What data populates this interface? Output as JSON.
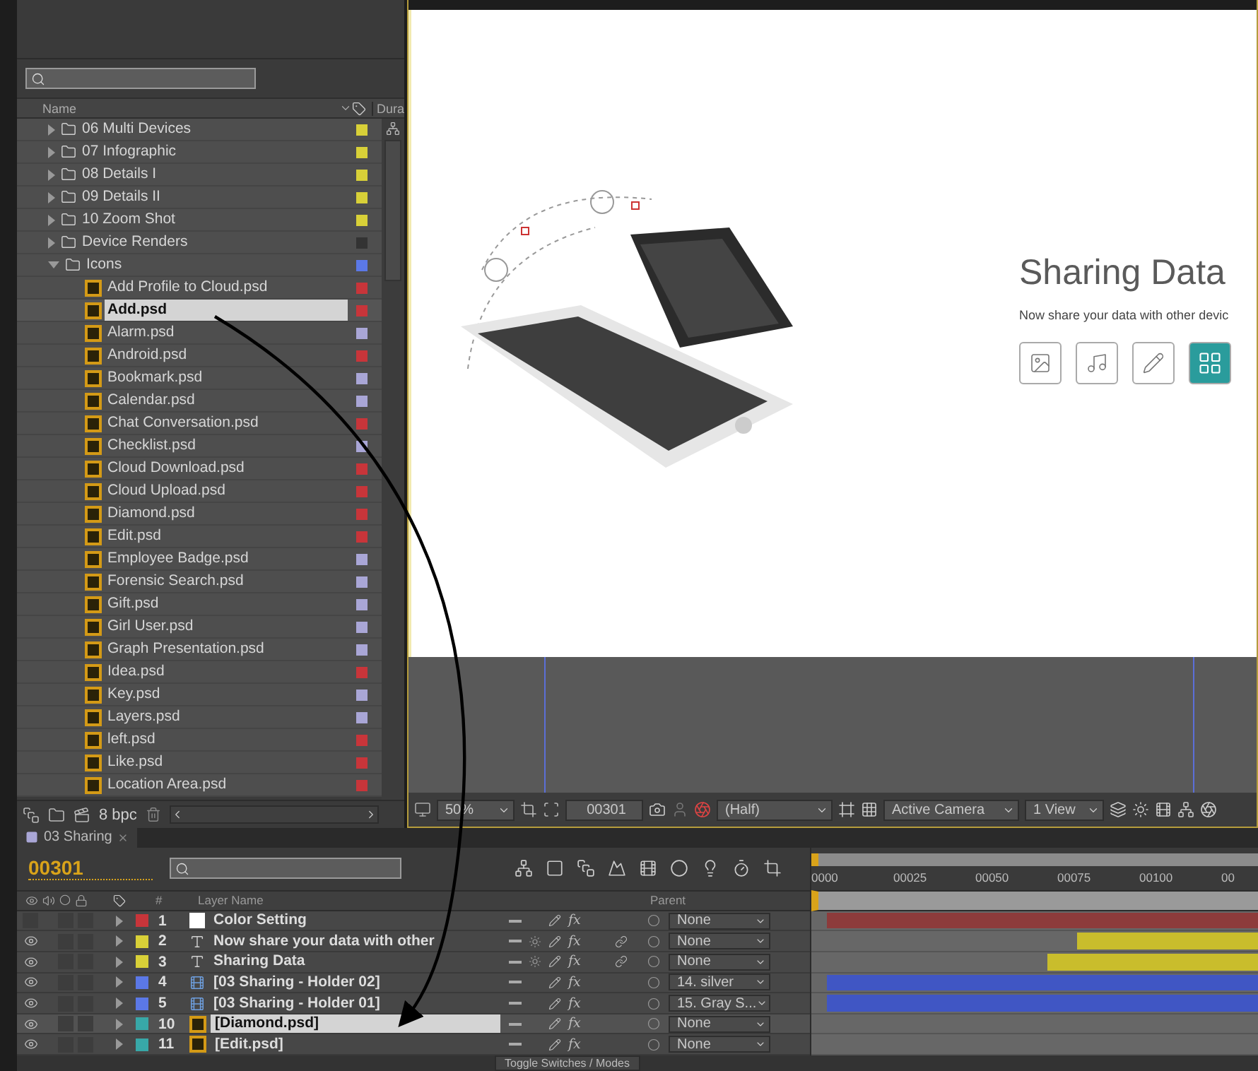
{
  "project": {
    "columns": [
      "Name",
      "Dura"
    ],
    "items": [
      {
        "name": "06 Multi Devices",
        "kind": "folder",
        "color": "#d8d038",
        "expanded": false,
        "selected": false
      },
      {
        "name": "07 Infographic",
        "kind": "folder",
        "color": "#d8d038",
        "expanded": false,
        "selected": false
      },
      {
        "name": "08 Details I",
        "kind": "folder",
        "color": "#d8d038",
        "expanded": false,
        "selected": false
      },
      {
        "name": "09 Details II",
        "kind": "folder",
        "color": "#d8d038",
        "expanded": false,
        "selected": false
      },
      {
        "name": "10 Zoom Shot",
        "kind": "folder",
        "color": "#d8d038",
        "expanded": false,
        "selected": false
      },
      {
        "name": "Device Renders",
        "kind": "folder",
        "color": "#333333",
        "expanded": false,
        "selected": false
      },
      {
        "name": "Icons",
        "kind": "folder",
        "color": "#5b78e6",
        "expanded": true,
        "selected": false,
        "children": [
          {
            "name": "Add Profile to Cloud.psd",
            "kind": "psd",
            "color": "#c8353a",
            "selected": false
          },
          {
            "name": "Add.psd",
            "kind": "psd",
            "color": "#c8353a",
            "selected": true
          },
          {
            "name": "Alarm.psd",
            "kind": "psd",
            "color": "#a9a6d6",
            "selected": false
          },
          {
            "name": "Android.psd",
            "kind": "psd",
            "color": "#c8353a",
            "selected": false
          },
          {
            "name": "Bookmark.psd",
            "kind": "psd",
            "color": "#a9a6d6",
            "selected": false
          },
          {
            "name": "Calendar.psd",
            "kind": "psd",
            "color": "#a9a6d6",
            "selected": false
          },
          {
            "name": "Chat Conversation.psd",
            "kind": "psd",
            "color": "#c8353a",
            "selected": false
          },
          {
            "name": "Checklist.psd",
            "kind": "psd",
            "color": "#a9a6d6",
            "selected": false
          },
          {
            "name": "Cloud Download.psd",
            "kind": "psd",
            "color": "#c8353a",
            "selected": false
          },
          {
            "name": "Cloud Upload.psd",
            "kind": "psd",
            "color": "#c8353a",
            "selected": false
          },
          {
            "name": "Diamond.psd",
            "kind": "psd",
            "color": "#c8353a",
            "selected": false
          },
          {
            "name": "Edit.psd",
            "kind": "psd",
            "color": "#c8353a",
            "selected": false
          },
          {
            "name": "Employee Badge.psd",
            "kind": "psd",
            "color": "#a9a6d6",
            "selected": false
          },
          {
            "name": "Forensic Search.psd",
            "kind": "psd",
            "color": "#a9a6d6",
            "selected": false
          },
          {
            "name": "Gift.psd",
            "kind": "psd",
            "color": "#a9a6d6",
            "selected": false
          },
          {
            "name": "Girl User.psd",
            "kind": "psd",
            "color": "#a9a6d6",
            "selected": false
          },
          {
            "name": "Graph Presentation.psd",
            "kind": "psd",
            "color": "#a9a6d6",
            "selected": false
          },
          {
            "name": "Idea.psd",
            "kind": "psd",
            "color": "#c8353a",
            "selected": false
          },
          {
            "name": "Key.psd",
            "kind": "psd",
            "color": "#a9a6d6",
            "selected": false
          },
          {
            "name": "Layers.psd",
            "kind": "psd",
            "color": "#a9a6d6",
            "selected": false
          },
          {
            "name": "left.psd",
            "kind": "psd",
            "color": "#c8353a",
            "selected": false
          },
          {
            "name": "Like.psd",
            "kind": "psd",
            "color": "#c8353a",
            "selected": false
          },
          {
            "name": "Location Area.psd",
            "kind": "psd",
            "color": "#c8353a",
            "selected": false
          }
        ]
      }
    ],
    "bit_depth": "8 bpc"
  },
  "viewer": {
    "title": "Sharing Data",
    "subtitle": "Now share your data with other devic",
    "toolbar": {
      "zoom": "50%",
      "time": "00301",
      "resolution": "(Half)",
      "camera": "Active Camera",
      "views": "1 View"
    }
  },
  "timeline": {
    "tab": "03 Sharing",
    "time": "00301",
    "columns": [
      "#",
      "Layer Name",
      "Parent"
    ],
    "ruler": [
      "0000",
      "00025",
      "00050",
      "00075",
      "00100",
      "00"
    ],
    "layers": [
      {
        "index": "1",
        "name": "Color Setting",
        "kind": "solid",
        "color": "#c8353a",
        "visible": false,
        "selected": false,
        "fx": "fx",
        "parent": "None",
        "bar": {
          "color": "#8d3b3b",
          "level": 1
        }
      },
      {
        "index": "2",
        "name": "Now share your data with other",
        "kind": "text",
        "color": "#d8d038",
        "visible": true,
        "selected": false,
        "fx": "fx",
        "parent": "None",
        "bar": {
          "color": "#c9bd2c",
          "level": 0.42
        }
      },
      {
        "index": "3",
        "name": "Sharing Data",
        "kind": "text",
        "color": "#d8d038",
        "visible": true,
        "selected": false,
        "fx": "fx",
        "parent": "None",
        "bar": {
          "color": "#c9bd2c",
          "level": 0.49
        }
      },
      {
        "index": "4",
        "name": "[03 Sharing - Holder 02]",
        "kind": "comp",
        "color": "#5b78e6",
        "visible": true,
        "selected": false,
        "fx": "fx",
        "parent": "14. silver",
        "bar": {
          "color": "#4056c4",
          "level": 1
        }
      },
      {
        "index": "5",
        "name": "[03 Sharing - Holder 01]",
        "kind": "comp",
        "color": "#5b78e6",
        "visible": true,
        "selected": false,
        "fx": "fx",
        "parent": "15. Gray S...",
        "bar": {
          "color": "#4056c4",
          "level": 1
        }
      },
      {
        "index": "10",
        "name": "[Diamond.psd]",
        "kind": "psd",
        "color": "#38a8a8",
        "visible": true,
        "selected": true,
        "fx": "fx",
        "parent": "None",
        "bar": {
          "level": 0
        }
      },
      {
        "index": "11",
        "name": "[Edit.psd]",
        "kind": "psd",
        "color": "#38a8a8",
        "visible": true,
        "selected": false,
        "fx": "fx",
        "parent": "None",
        "bar": {
          "level": 0
        }
      }
    ],
    "toggle_label": "Toggle Switches / Modes"
  }
}
